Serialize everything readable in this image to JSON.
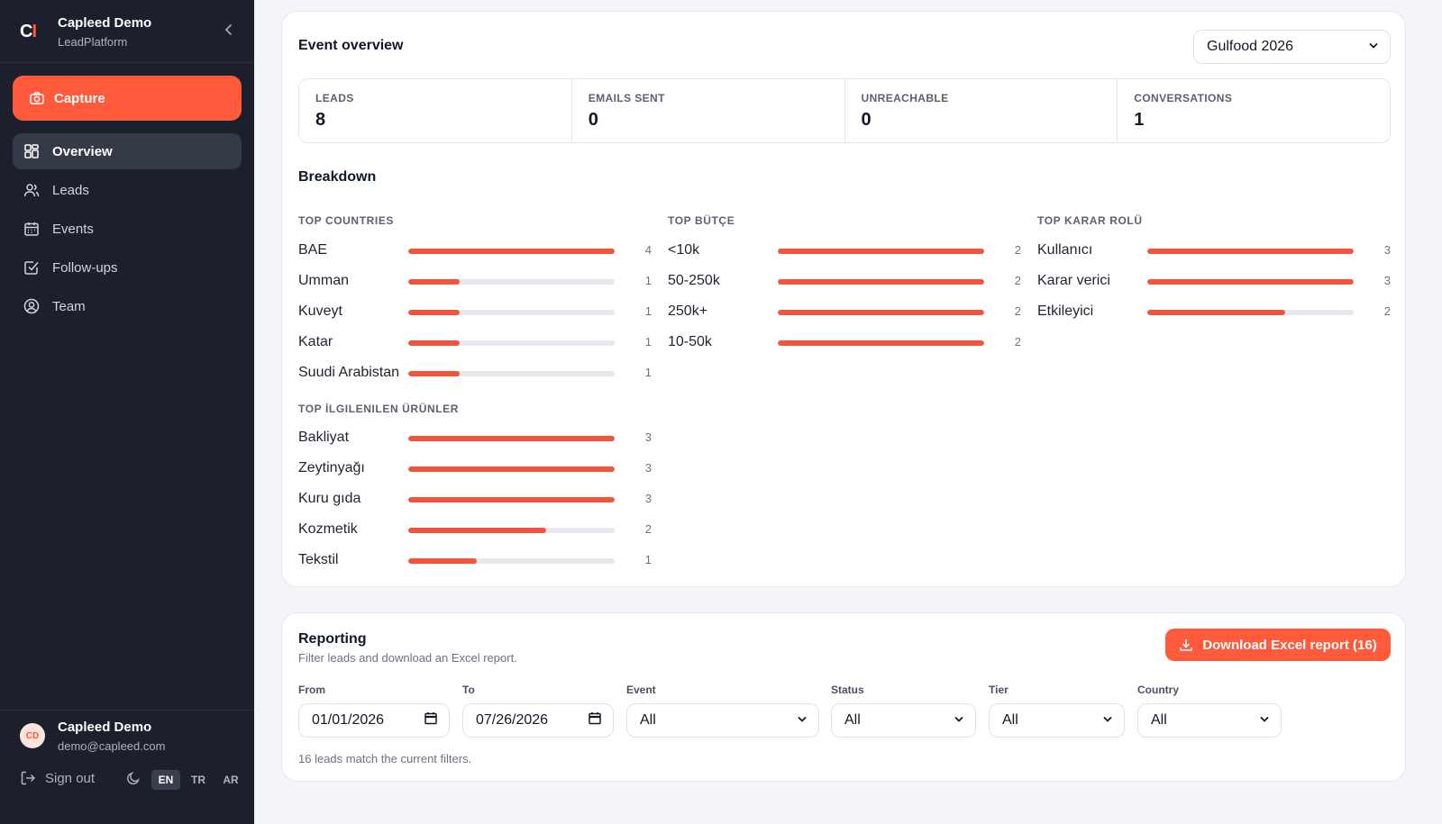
{
  "sidebar": {
    "logo_main": "C",
    "logo_accent": "I",
    "org_name": "Capleed Demo",
    "org_sub": "LeadPlatform",
    "capture_label": "Capture",
    "nav": [
      {
        "label": "Overview",
        "icon": "grid-icon",
        "active": true
      },
      {
        "label": "Leads",
        "icon": "users-icon"
      },
      {
        "label": "Events",
        "icon": "calendar-icon"
      },
      {
        "label": "Follow-ups",
        "icon": "check-square-icon"
      },
      {
        "label": "Team",
        "icon": "user-circle-icon"
      }
    ],
    "user": {
      "initials": "CD",
      "name": "Capleed Demo",
      "email": "demo@capleed.com"
    },
    "sign_out": "Sign out",
    "languages": [
      "EN",
      "TR",
      "AR"
    ],
    "active_language": "EN"
  },
  "overview": {
    "title": "Event overview",
    "event_select": "Gulfood 2026",
    "stats": [
      {
        "label": "LEADS",
        "value": "8"
      },
      {
        "label": "EMAILS SENT",
        "value": "0"
      },
      {
        "label": "UNREACHABLE",
        "value": "0"
      },
      {
        "label": "CONVERSATIONS",
        "value": "1"
      }
    ],
    "breakdown_title": "Breakdown",
    "groups": {
      "countries": {
        "label": "TOP COUNTRIES",
        "rows": [
          {
            "label": "BAE",
            "count": "4",
            "fraction": 1.0
          },
          {
            "label": "Umman",
            "count": "1",
            "fraction": 0.25
          },
          {
            "label": "Kuveyt",
            "count": "1",
            "fraction": 0.25
          },
          {
            "label": "Katar",
            "count": "1",
            "fraction": 0.25
          },
          {
            "label": "Suudi Arabistan",
            "count": "1",
            "fraction": 0.25
          }
        ]
      },
      "budget": {
        "label": "TOP BÜTÇE",
        "rows": [
          {
            "label": "<10k",
            "count": "2",
            "fraction": 1.0
          },
          {
            "label": "50-250k",
            "count": "2",
            "fraction": 1.0
          },
          {
            "label": "250k+",
            "count": "2",
            "fraction": 1.0
          },
          {
            "label": "10-50k",
            "count": "2",
            "fraction": 1.0
          }
        ]
      },
      "roles": {
        "label": "TOP KARAR ROLÜ",
        "rows": [
          {
            "label": "Kullanıcı",
            "count": "3",
            "fraction": 1.0
          },
          {
            "label": "Karar verici",
            "count": "3",
            "fraction": 1.0
          },
          {
            "label": "Etkileyici",
            "count": "2",
            "fraction": 0.667
          }
        ]
      },
      "products": {
        "label": "TOP İLGILENILEN ÜRÜNLER",
        "rows": [
          {
            "label": "Bakliyat",
            "count": "3",
            "fraction": 1.0
          },
          {
            "label": "Zeytinyağı",
            "count": "3",
            "fraction": 1.0
          },
          {
            "label": "Kuru gıda",
            "count": "3",
            "fraction": 1.0
          },
          {
            "label": "Kozmetik",
            "count": "2",
            "fraction": 0.667
          },
          {
            "label": "Tekstil",
            "count": "1",
            "fraction": 0.333
          }
        ]
      }
    }
  },
  "reporting": {
    "title": "Reporting",
    "subtitle": "Filter leads and download an Excel report.",
    "download_label": "Download Excel report (16)",
    "filters": {
      "from": {
        "label": "From",
        "value": "01/01/2026"
      },
      "to": {
        "label": "To",
        "value": "07/26/2026"
      },
      "event": {
        "label": "Event",
        "value": "All"
      },
      "status": {
        "label": "Status",
        "value": "All"
      },
      "tier": {
        "label": "Tier",
        "value": "All"
      },
      "country": {
        "label": "Country",
        "value": "All"
      }
    },
    "match_text": "16 leads match the current filters."
  },
  "colors": {
    "accent": "#ff5a3c",
    "sidebar_bg": "#1b202c",
    "bar_fill": "#f0563e",
    "bar_track": "#e6e8ee"
  }
}
